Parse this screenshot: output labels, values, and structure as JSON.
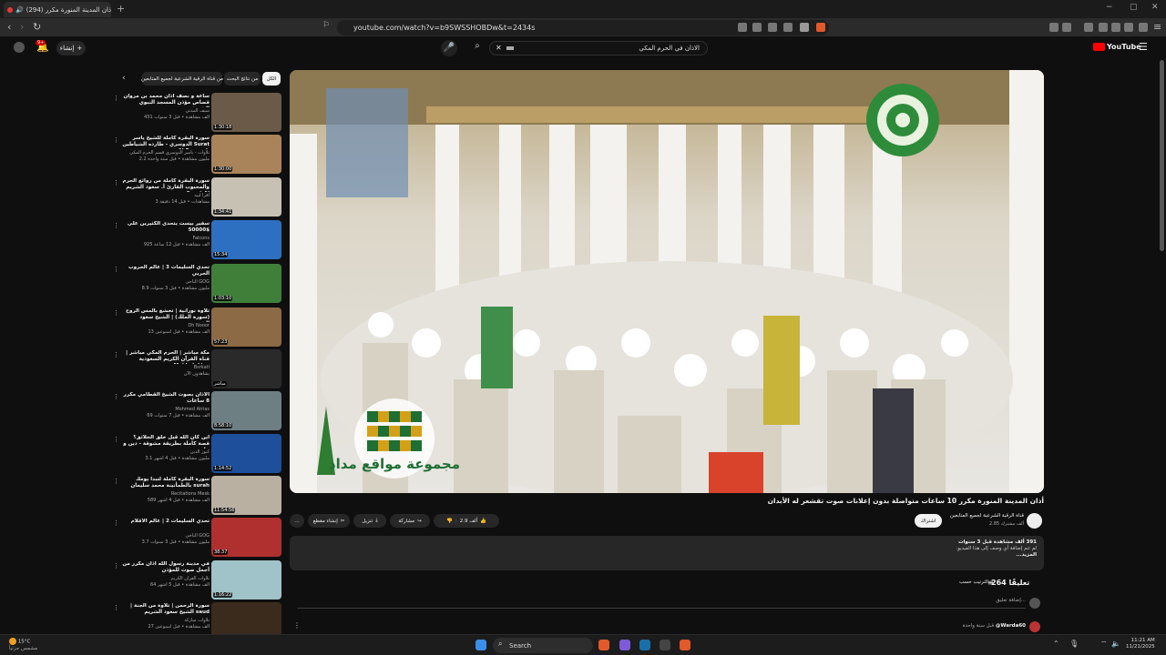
{
  "browser": {
    "tab_title": "(294) أذان المدينة المنورة مكرر",
    "new_tab": "+",
    "url": "youtube.com/watch?v=b9SWSSHOBDw&t=2434s",
    "window_controls": [
      "−",
      "▢",
      "✕"
    ]
  },
  "header": {
    "search_query": "الاذان في الحرم المكي",
    "create_label": "إنشاء",
    "notification_count": "9+",
    "logo_text": "YouTube"
  },
  "sidebar": {
    "chips": [
      "الكل",
      "من نتائج البحث",
      "من قناة الرقية الشرعية لجميع المتابعين"
    ],
    "videos": [
      {
        "title": "ساعة و نصف أذان محمد بن مروان قصاص مؤذن المسجد النبوي الشريف",
        "channel": "سيف المدني",
        "meta": "431 ألف مشاهدة • قبل 3 سنوات",
        "duration": "1:30:18"
      },
      {
        "title": "سورة البقرة كاملة للشيخ ياسر الدوسري - طارده الشياطين Surat Al Baqarah",
        "channel": "تلاوات - ياسر الدوسري قسم الحرم المكي",
        "meta": "2.2 مليون مشاهدة • قبل سنة واحدة",
        "duration": "1:30:00"
      },
      {
        "title": "سورة البقرة كاملة من روائع الحرم والمحبوب القارئ أ. سعود الشريم Surat Al",
        "channel": "أقرأ لبيه",
        "meta": "3 مشاهدات • قبل 14 دقيقة",
        "duration": "1:34:41"
      },
      {
        "title": "سفير بيست يتحدى الكثيرين على $50000",
        "channel": "Falcons",
        "meta": "925 ألف مشاهدة • قبل 12 ساعة",
        "duration": "15:34"
      },
      {
        "title": "تحدي السليمات 3 | عالم الحروب الحربي",
        "channel": "الناجي GOG",
        "meta": "8.9 مليون مشاهدة • قبل 3 سنوات",
        "duration": "1:03:10"
      },
      {
        "title": "تلاوة نورانية | تخشع بالمس الروح (سورة الملك) | الشيخ سعود الشريم",
        "channel": "Dh Nooor",
        "meta": "13 ألف مشاهدة • قبل أسبوعين",
        "duration": "57:23"
      },
      {
        "title": "مكة مباشر | الحرم المكي مباشر | قناة القرآن الكريم السعودية Makkah Live",
        "channel": "Bsrkati",
        "meta": "يشاهدون الآن",
        "duration": "مباشر"
      },
      {
        "title": "الأذان بصوت الشيخ القطامي مكرر 8 ساعات",
        "channel": "Mohmed Atrias",
        "meta": "69 ألف مشاهدة • قبل 7 سنوات",
        "duration": "8:58:10"
      },
      {
        "title": "أين كان الله قبل خلق الخلائق؟ قصة كاملة بطريقة مشوقة - دين و خلق",
        "channel": "كنوز الدين",
        "meta": "3.1 مليون مشاهدة • قبل 4 أشهر",
        "duration": "1:14:52"
      },
      {
        "title": "سورة البقرة كاملة لتبدأ يومك بالطمأنينة محمد سليمان surah",
        "channel": "Recitations Mesk",
        "meta": "589 ألف مشاهدة • قبل 4 أشهر",
        "duration": "11:54:56"
      },
      {
        "title": "تحدي السليمات 2 | عالم الأقلام",
        "channel": "الناجي GOG",
        "meta": "3.7 مليون مشاهدة • قبل 3 سنوات",
        "duration": "38:37"
      },
      {
        "title": "في مدينة رسول الله أذان مكرر من أجمل صوت للمؤذن",
        "channel": "تلاوات القرآن الكريم",
        "meta": "64 ألف مشاهدة • قبل 5 أشهر",
        "duration": "1:16:22"
      },
      {
        "title": "سورة الرحمن | تلاوة من الجنة | الشيخ سعود الشريم saud",
        "channel": "تلاوات مباركة",
        "meta": "27 ألف مشاهدة • قبل أسبوعين",
        "duration": "1:20:00"
      }
    ]
  },
  "player": {
    "watermark_text": "مجموعة مواقع مداد"
  },
  "video": {
    "title": "أذان المدينة المنورة مكرر 10 ساعات متواصلة بدون إعلانات صوت تقشعر له الأبدان",
    "channel_name": "قناة الرقية الشرعية لجميع المتابعين",
    "subscribers": "2.85 ألف مشترك",
    "subscribe_label": "اشتراك",
    "likes": "2.9 ألف",
    "share_label": "مشاركة",
    "download_label": "تنزيل",
    "clip_label": "إنشاء مقطع",
    "more": "…",
    "description_stats": "391 ألف مشاهدة  قبل 3 سنوات",
    "description_text": "لم تتم إضافة أي وصف إلى هذا الفيديو.",
    "description_more": "المزيد...",
    "comments_count": "264 تعليقًا",
    "sort_label": "الترتيب حسب",
    "add_comment_placeholder": "إضافة تعليق...",
    "first_commenter": "@Warda60",
    "first_comment_time": "قبل سنة واحدة"
  },
  "taskbar": {
    "weather_temp": "15°C",
    "weather_desc": "مشمس جزئياً",
    "search_label": "Search",
    "time": "11:21 AM",
    "date": "11/21/2025"
  },
  "colors": {
    "accent": "#ff0000",
    "background": "#0f0f0f"
  }
}
